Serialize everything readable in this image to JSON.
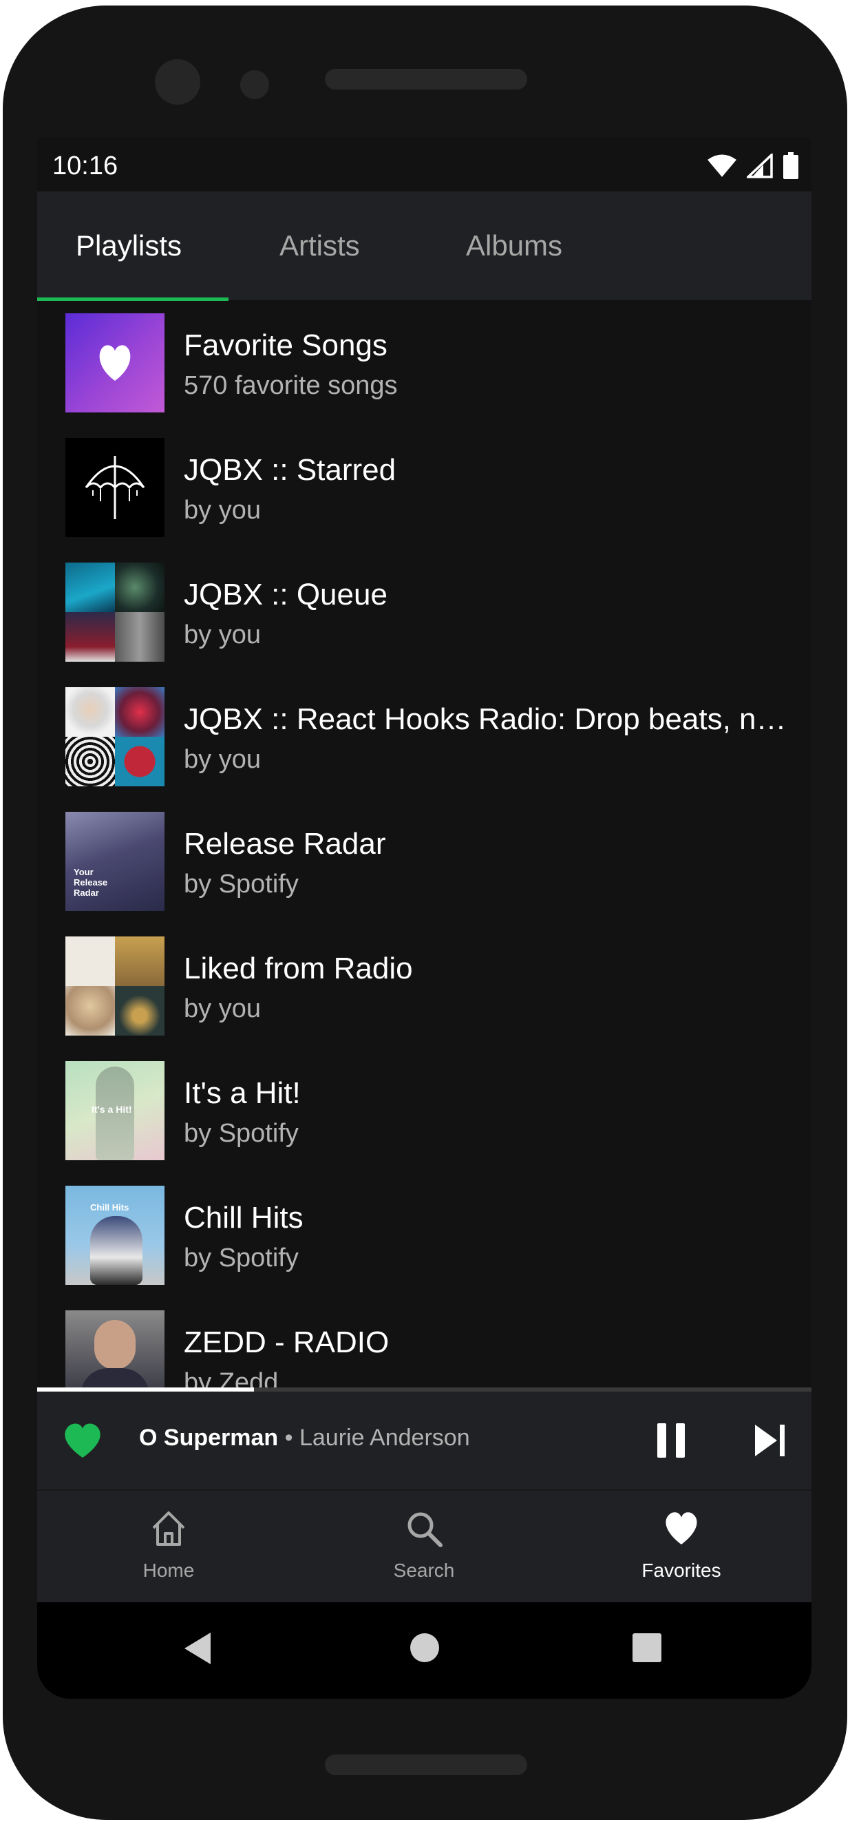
{
  "status_bar": {
    "time": "10:16",
    "icons": [
      "wifi-icon",
      "signal-icon",
      "battery-icon"
    ]
  },
  "tabs": [
    {
      "label": "Playlists",
      "active": true
    },
    {
      "label": "Artists",
      "active": false
    },
    {
      "label": "Albums",
      "active": false
    }
  ],
  "accent_color": "#1db954",
  "playlists": [
    {
      "title": "Favorite Songs",
      "subtitle": "570 favorite songs"
    },
    {
      "title": "JQBX :: Starred",
      "subtitle": "by you"
    },
    {
      "title": "JQBX :: Queue",
      "subtitle": "by you"
    },
    {
      "title": "JQBX :: React Hooks Radio: Drop beats, not bugs",
      "subtitle": "by you"
    },
    {
      "title": "Release Radar",
      "subtitle": "by Spotify",
      "cover_text": "Your Release Radar"
    },
    {
      "title": "Liked from Radio",
      "subtitle": "by you"
    },
    {
      "title": "It's a Hit!",
      "subtitle": "by Spotify",
      "cover_text": "It's a Hit!"
    },
    {
      "title": "Chill Hits",
      "subtitle": "by Spotify",
      "cover_text": "Chill Hits"
    },
    {
      "title": "ZEDD - RADIO",
      "subtitle": "by Zedd"
    }
  ],
  "now_playing": {
    "title": "O Superman",
    "separator": " • ",
    "artist": "Laurie Anderson",
    "liked": true,
    "progress": 0.28
  },
  "bottom_nav": [
    {
      "label": "Home",
      "icon": "home-icon",
      "active": false
    },
    {
      "label": "Search",
      "icon": "search-icon",
      "active": false
    },
    {
      "label": "Favorites",
      "icon": "heart-icon",
      "active": true
    }
  ],
  "system_nav": [
    "back-icon",
    "home-circle-icon",
    "recents-icon"
  ]
}
